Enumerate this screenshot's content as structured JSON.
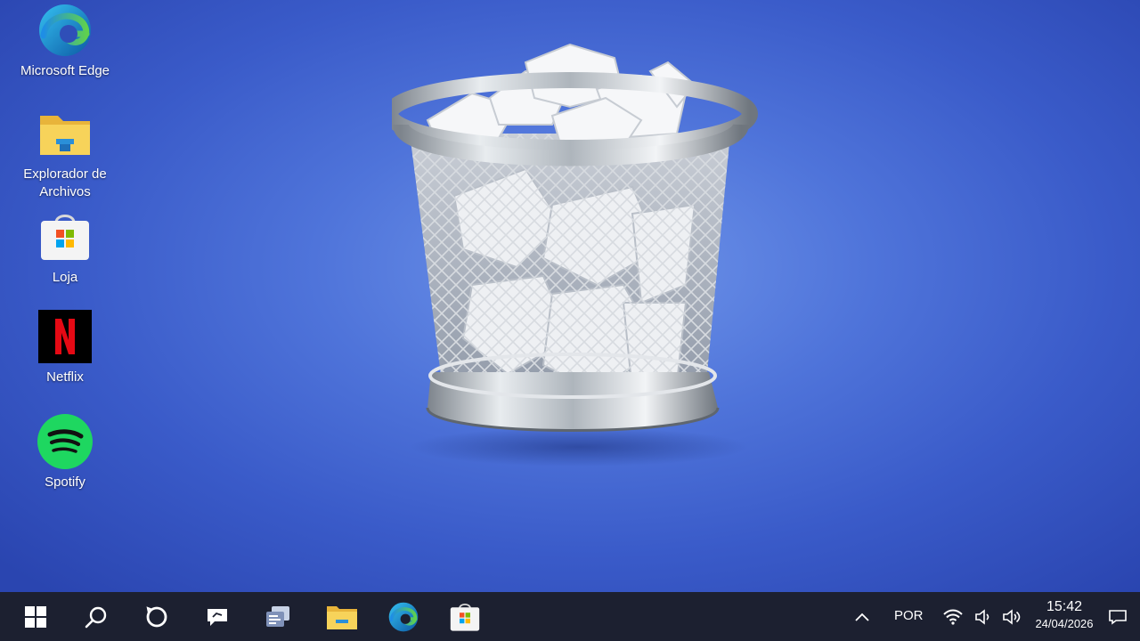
{
  "desktop": {
    "background_color": "#4f74da",
    "icons": [
      {
        "label": "Microsoft Edge",
        "icon": "edge-icon"
      },
      {
        "label": "Explorador de\nArchivos",
        "icon": "folder-icon"
      },
      {
        "label": "Loja",
        "icon": "store-icon"
      },
      {
        "label": "Netflix",
        "icon": "netflix-icon"
      },
      {
        "label": "Spotify",
        "icon": "spotify-icon"
      }
    ],
    "wallpaper_subject": "recycle-bin-full-icon"
  },
  "taskbar": {
    "background_color": "#1c2030",
    "buttons": [
      {
        "icon": "windows-start-icon"
      },
      {
        "icon": "search-icon"
      },
      {
        "icon": "cortana-icon"
      },
      {
        "icon": "chat-icon"
      },
      {
        "icon": "task-view-icon"
      },
      {
        "icon": "folder-icon"
      },
      {
        "icon": "edge-icon"
      },
      {
        "icon": "store-icon"
      }
    ],
    "tray": {
      "language": "POR",
      "time": "15:42",
      "date": "24/04/2026"
    }
  }
}
